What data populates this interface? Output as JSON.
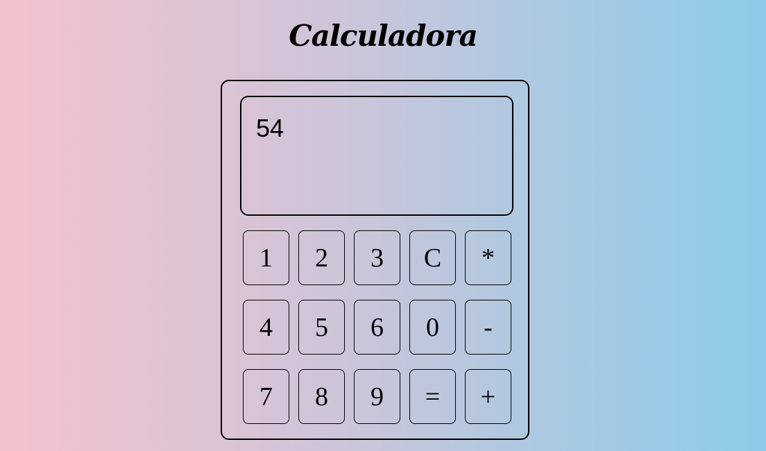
{
  "app": {
    "title": "Calculadora"
  },
  "display": {
    "value": "54"
  },
  "keys": {
    "row1": [
      "1",
      "2",
      "3",
      "C",
      "*"
    ],
    "row2": [
      "4",
      "5",
      "6",
      "0",
      "-"
    ],
    "row3": [
      "7",
      "8",
      "9",
      "=",
      "+"
    ]
  }
}
